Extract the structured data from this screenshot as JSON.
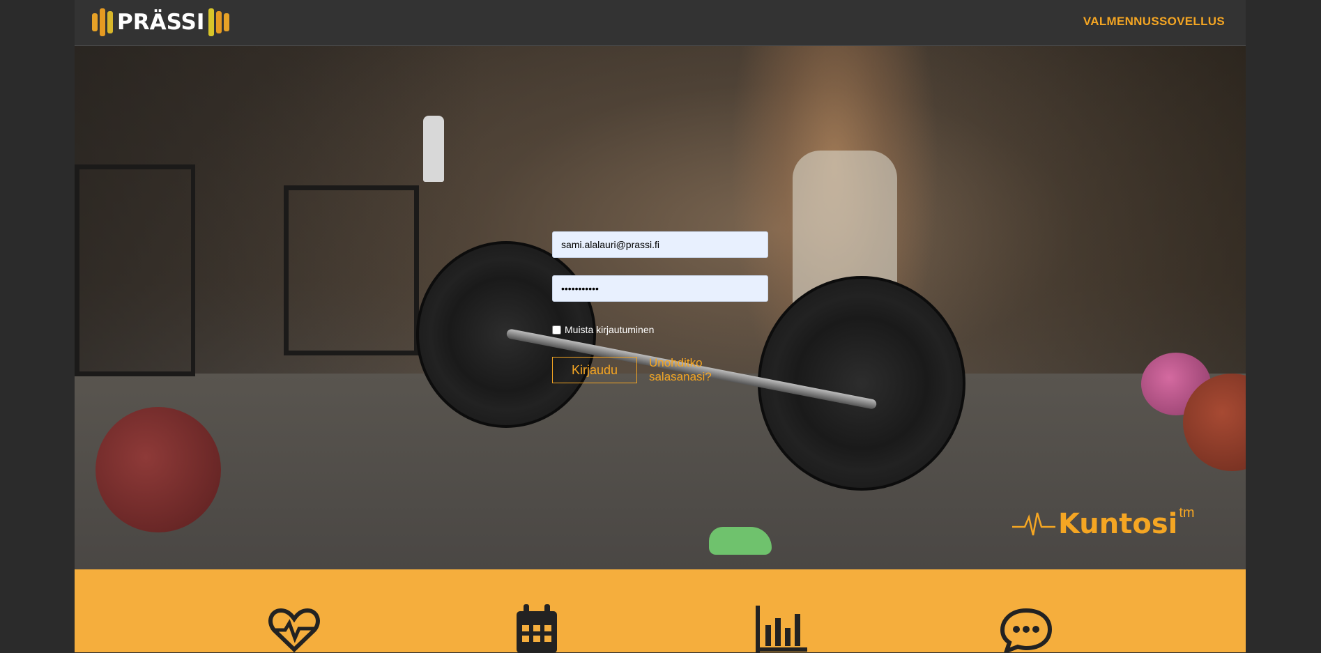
{
  "header": {
    "logo_text": "PRÄSSI",
    "nav_link": "VALMENNUSSOVELLUS"
  },
  "login": {
    "email_value": "sami.alalauri@prassi.fi",
    "password_value": "•••••••••••",
    "remember_label": "Muista kirjautuminen",
    "submit_label": "Kirjaudu",
    "forgot_link": "Unohditko salasanasi?"
  },
  "hero": {
    "brand_word": "Kuntosi",
    "brand_tm": "tm"
  },
  "features": {
    "icons": [
      "heart-pulse-icon",
      "calendar-icon",
      "bar-chart-icon",
      "chat-bubble-icon"
    ]
  },
  "colors": {
    "accent": "#f5a623",
    "header_bg": "#333333",
    "input_bg": "#e8f0fe",
    "features_bg": "#f5ae3d"
  }
}
